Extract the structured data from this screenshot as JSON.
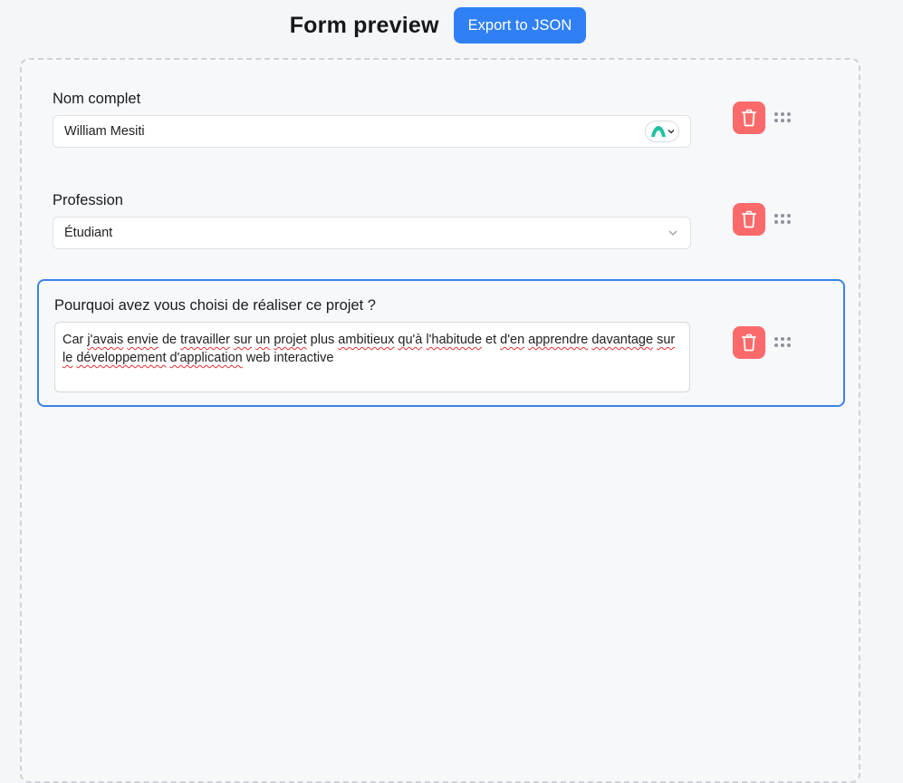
{
  "header": {
    "title": "Form preview",
    "export_label": "Export to JSON"
  },
  "fields": [
    {
      "label": "Nom complet",
      "value": "William Mesiti"
    },
    {
      "label": "Profession",
      "value": "Étudiant"
    },
    {
      "label": "Pourquoi avez vous choisi de réaliser ce projet ?",
      "value": "Car j'avais envie de travailler sur un projet plus ambitieux qu'à l'habitude et d'en apprendre davantage sur le développement d'application web interactive"
    }
  ],
  "icons": {
    "delete": "trash-icon",
    "drag": "drag-handle-icon",
    "extension": "autofill-extension-icon",
    "dropdown": "chevron-down-icon"
  },
  "colors": {
    "accent": "#2f80f5",
    "delete": "#fb6a6a",
    "selected_border": "#3b82e8",
    "extension": "#1fc1a2"
  }
}
